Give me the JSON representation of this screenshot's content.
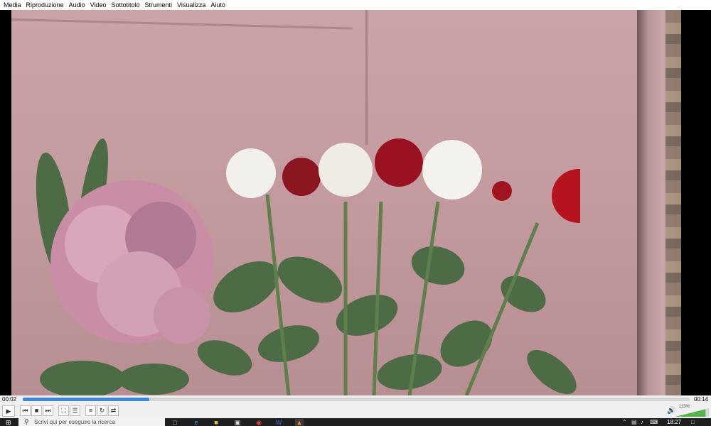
{
  "menu": {
    "items": [
      "Media",
      "Riproduzione",
      "Audio",
      "Video",
      "Sottotitolo",
      "Strumenti",
      "Visualizza",
      "Aiuto"
    ]
  },
  "player": {
    "time_elapsed": "00:02",
    "time_total": "00:14",
    "progress_fraction": 0.19,
    "volume_percent_label": "113%",
    "volume_fraction": 0.9
  },
  "controls": {
    "play_icon": "play-icon",
    "prev_icon": "previous-icon",
    "stop_icon": "stop-icon",
    "next_icon": "next-icon",
    "fullscreen_icon": "fullscreen-icon",
    "extended_icon": "equalizer-icon",
    "playlist_icon": "playlist-icon",
    "loop_icon": "loop-icon",
    "shuffle_icon": "shuffle-icon",
    "volume_icon": "speaker-icon"
  },
  "taskbar": {
    "search_placeholder": "Scrivi qui per eseguire la ricerca",
    "clock": "18:27"
  },
  "colors": {
    "accent": "#3a87d6",
    "taskbar_bg": "#1f1f22",
    "control_bg": "#f0f0f0"
  }
}
